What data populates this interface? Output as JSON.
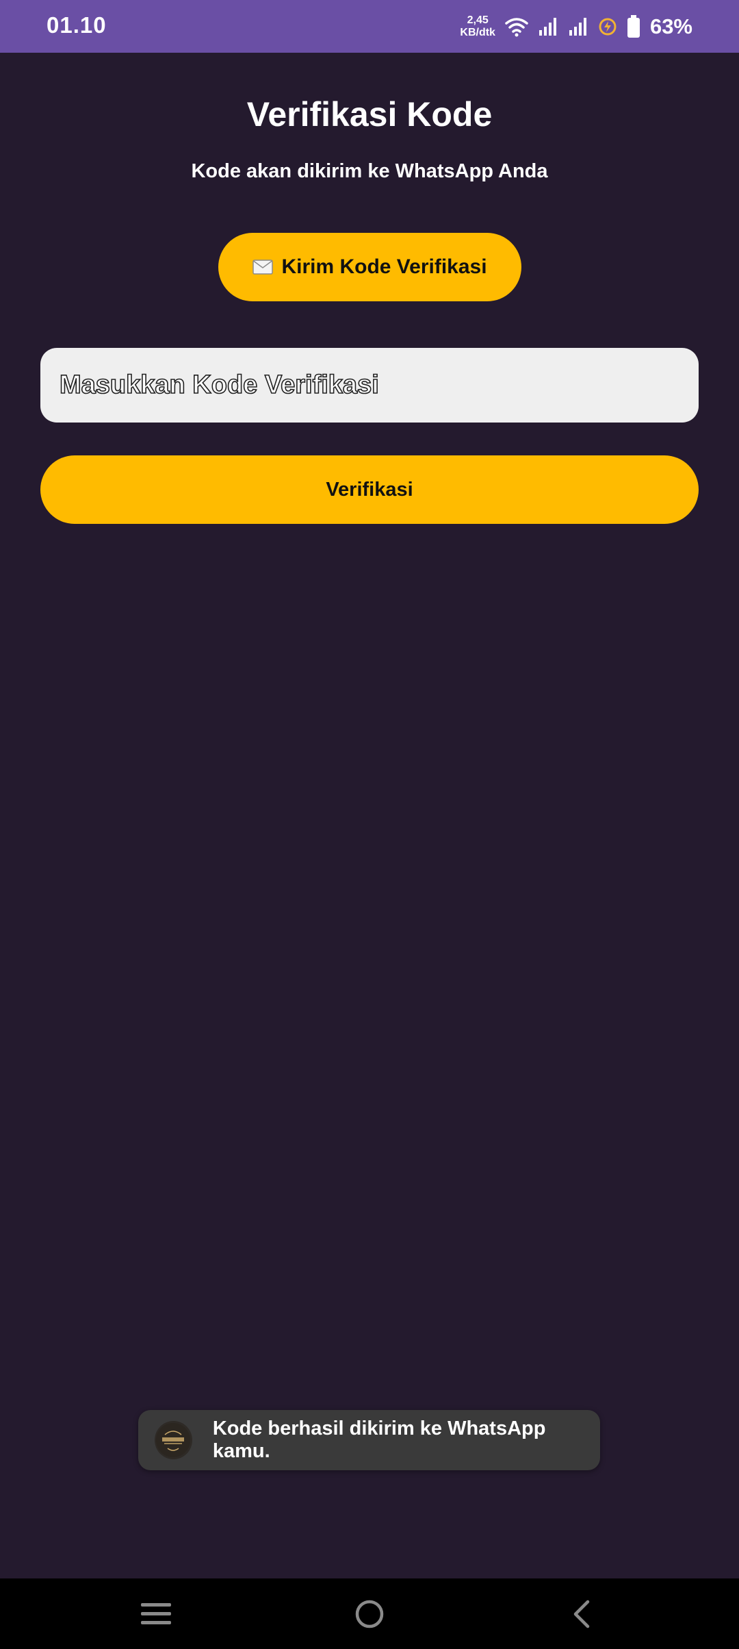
{
  "status_bar": {
    "time": "01.10",
    "net_speed_value": "2,45",
    "net_speed_unit": "KB/dtk",
    "battery_percent": "63%",
    "background_color": "#6a4fa5"
  },
  "page": {
    "title": "Verifikasi Kode",
    "subtitle": "Kode akan dikirim ke WhatsApp Anda",
    "background_color": "#241a2e",
    "accent_color": "#ffbb00"
  },
  "send_button": {
    "icon": "envelope-icon",
    "label": "Kirim Kode Verifikasi"
  },
  "code_input": {
    "placeholder": "Masukkan Kode Verifikasi",
    "value": ""
  },
  "verify_button": {
    "label": "Verifikasi"
  },
  "toast": {
    "logo_icon": "app-logo-icon",
    "message": "Kode berhasil dikirim ke WhatsApp kamu."
  },
  "nav_bar": {
    "recents_icon": "menu-lines-icon",
    "home_icon": "home-circle-icon",
    "back_icon": "back-chevron-icon"
  }
}
